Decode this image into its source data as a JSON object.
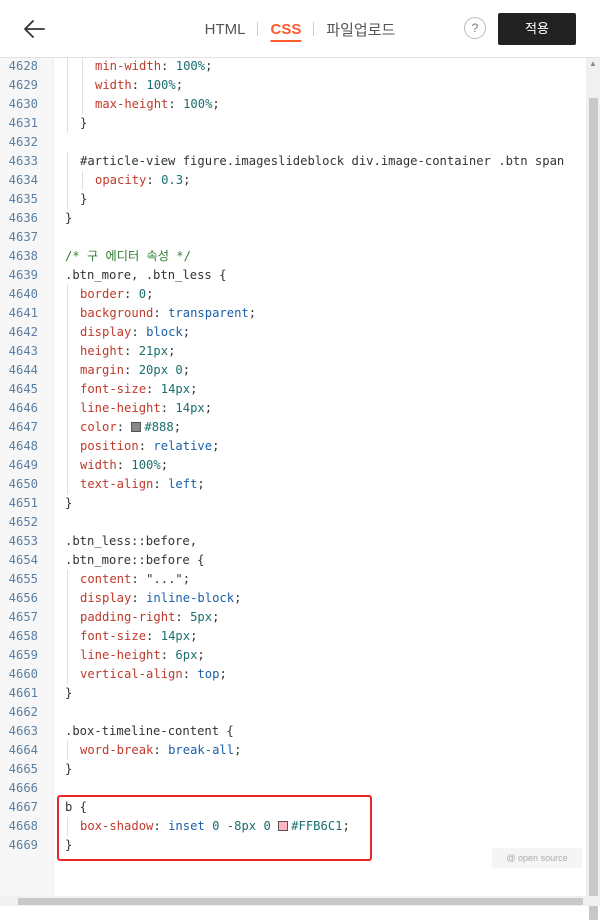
{
  "header": {
    "tabs": [
      {
        "label": "HTML",
        "active": false
      },
      {
        "label": "CSS",
        "active": true
      },
      {
        "label": "파일업로드",
        "active": false
      }
    ],
    "help_label": "?",
    "apply_label": "적용",
    "accent": "#ff5a2e"
  },
  "watermark": "@ open source",
  "code_lines": [
    {
      "n": "4628",
      "indent": 2,
      "tokens": [
        [
          "prop",
          "min-width"
        ],
        [
          "punc",
          ": "
        ],
        [
          "num",
          "100%"
        ],
        [
          "punc",
          ";"
        ]
      ]
    },
    {
      "n": "4629",
      "indent": 2,
      "tokens": [
        [
          "prop",
          "width"
        ],
        [
          "punc",
          ": "
        ],
        [
          "num",
          "100%"
        ],
        [
          "punc",
          ";"
        ]
      ]
    },
    {
      "n": "4630",
      "indent": 2,
      "tokens": [
        [
          "prop",
          "max-height"
        ],
        [
          "punc",
          ": "
        ],
        [
          "num",
          "100%"
        ],
        [
          "punc",
          ";"
        ]
      ]
    },
    {
      "n": "4631",
      "indent": 1,
      "tokens": [
        [
          "punc",
          "}"
        ]
      ]
    },
    {
      "n": "4632",
      "indent": 0,
      "tokens": []
    },
    {
      "n": "4633",
      "indent": 1,
      "tokens": [
        [
          "sel",
          "#article-view figure.imageslideblock div.image-container .btn span"
        ]
      ]
    },
    {
      "n": "4634",
      "indent": 2,
      "tokens": [
        [
          "prop",
          "opacity"
        ],
        [
          "punc",
          ": "
        ],
        [
          "num",
          "0.3"
        ],
        [
          "punc",
          ";"
        ]
      ]
    },
    {
      "n": "4635",
      "indent": 1,
      "tokens": [
        [
          "punc",
          "}"
        ]
      ]
    },
    {
      "n": "4636",
      "indent": 0,
      "tokens": [
        [
          "punc",
          "}"
        ]
      ]
    },
    {
      "n": "4637",
      "indent": 0,
      "tokens": []
    },
    {
      "n": "4638",
      "indent": 0,
      "tokens": [
        [
          "comment",
          "/* 구 에디터 속성 */"
        ]
      ]
    },
    {
      "n": "4639",
      "indent": 0,
      "tokens": [
        [
          "sel",
          ".btn_more, .btn_less {"
        ]
      ]
    },
    {
      "n": "4640",
      "indent": 1,
      "tokens": [
        [
          "prop",
          "border"
        ],
        [
          "punc",
          ": "
        ],
        [
          "num",
          "0"
        ],
        [
          "punc",
          ";"
        ]
      ]
    },
    {
      "n": "4641",
      "indent": 1,
      "tokens": [
        [
          "prop",
          "background"
        ],
        [
          "punc",
          ": "
        ],
        [
          "kw",
          "transparent"
        ],
        [
          "punc",
          ";"
        ]
      ]
    },
    {
      "n": "4642",
      "indent": 1,
      "tokens": [
        [
          "prop",
          "display"
        ],
        [
          "punc",
          ": "
        ],
        [
          "kw",
          "block"
        ],
        [
          "punc",
          ";"
        ]
      ]
    },
    {
      "n": "4643",
      "indent": 1,
      "tokens": [
        [
          "prop",
          "height"
        ],
        [
          "punc",
          ": "
        ],
        [
          "num",
          "21px"
        ],
        [
          "punc",
          ";"
        ]
      ]
    },
    {
      "n": "4644",
      "indent": 1,
      "tokens": [
        [
          "prop",
          "margin"
        ],
        [
          "punc",
          ": "
        ],
        [
          "num",
          "20px 0"
        ],
        [
          "punc",
          ";"
        ]
      ]
    },
    {
      "n": "4645",
      "indent": 1,
      "tokens": [
        [
          "prop",
          "font-size"
        ],
        [
          "punc",
          ": "
        ],
        [
          "num",
          "14px"
        ],
        [
          "punc",
          ";"
        ]
      ]
    },
    {
      "n": "4646",
      "indent": 1,
      "tokens": [
        [
          "prop",
          "line-height"
        ],
        [
          "punc",
          ": "
        ],
        [
          "num",
          "14px"
        ],
        [
          "punc",
          ";"
        ]
      ]
    },
    {
      "n": "4647",
      "indent": 1,
      "tokens": [
        [
          "prop",
          "color"
        ],
        [
          "punc",
          ": "
        ],
        [
          "swatch",
          "#888888"
        ],
        [
          "num",
          "#888"
        ],
        [
          "punc",
          ";"
        ]
      ]
    },
    {
      "n": "4648",
      "indent": 1,
      "tokens": [
        [
          "prop",
          "position"
        ],
        [
          "punc",
          ": "
        ],
        [
          "kw",
          "relative"
        ],
        [
          "punc",
          ";"
        ]
      ]
    },
    {
      "n": "4649",
      "indent": 1,
      "tokens": [
        [
          "prop",
          "width"
        ],
        [
          "punc",
          ": "
        ],
        [
          "num",
          "100%"
        ],
        [
          "punc",
          ";"
        ]
      ]
    },
    {
      "n": "4650",
      "indent": 1,
      "tokens": [
        [
          "prop",
          "text-align"
        ],
        [
          "punc",
          ": "
        ],
        [
          "kw",
          "left"
        ],
        [
          "punc",
          ";"
        ]
      ]
    },
    {
      "n": "4651",
      "indent": 0,
      "tokens": [
        [
          "punc",
          "}"
        ]
      ]
    },
    {
      "n": "4652",
      "indent": 0,
      "tokens": []
    },
    {
      "n": "4653",
      "indent": 0,
      "tokens": [
        [
          "sel",
          ".btn_less::before,"
        ]
      ]
    },
    {
      "n": "4654",
      "indent": 0,
      "tokens": [
        [
          "sel",
          ".btn_more::before {"
        ]
      ]
    },
    {
      "n": "4655",
      "indent": 1,
      "tokens": [
        [
          "prop",
          "content"
        ],
        [
          "punc",
          ": "
        ],
        [
          "str",
          "\"...\""
        ],
        [
          "punc",
          ";"
        ]
      ]
    },
    {
      "n": "4656",
      "indent": 1,
      "tokens": [
        [
          "prop",
          "display"
        ],
        [
          "punc",
          ": "
        ],
        [
          "kw",
          "inline-block"
        ],
        [
          "punc",
          ";"
        ]
      ]
    },
    {
      "n": "4657",
      "indent": 1,
      "tokens": [
        [
          "prop",
          "padding-right"
        ],
        [
          "punc",
          ": "
        ],
        [
          "num",
          "5px"
        ],
        [
          "punc",
          ";"
        ]
      ]
    },
    {
      "n": "4658",
      "indent": 1,
      "tokens": [
        [
          "prop",
          "font-size"
        ],
        [
          "punc",
          ": "
        ],
        [
          "num",
          "14px"
        ],
        [
          "punc",
          ";"
        ]
      ]
    },
    {
      "n": "4659",
      "indent": 1,
      "tokens": [
        [
          "prop",
          "line-height"
        ],
        [
          "punc",
          ": "
        ],
        [
          "num",
          "6px"
        ],
        [
          "punc",
          ";"
        ]
      ]
    },
    {
      "n": "4660",
      "indent": 1,
      "tokens": [
        [
          "prop",
          "vertical-align"
        ],
        [
          "punc",
          ": "
        ],
        [
          "kw",
          "top"
        ],
        [
          "punc",
          ";"
        ]
      ]
    },
    {
      "n": "4661",
      "indent": 0,
      "tokens": [
        [
          "punc",
          "}"
        ]
      ]
    },
    {
      "n": "4662",
      "indent": 0,
      "tokens": []
    },
    {
      "n": "4663",
      "indent": 0,
      "tokens": [
        [
          "sel",
          ".box-timeline-content {"
        ]
      ]
    },
    {
      "n": "4664",
      "indent": 1,
      "tokens": [
        [
          "prop",
          "word-break"
        ],
        [
          "punc",
          ": "
        ],
        [
          "kw",
          "break-all"
        ],
        [
          "punc",
          ";"
        ]
      ]
    },
    {
      "n": "4665",
      "indent": 0,
      "tokens": [
        [
          "punc",
          "}"
        ]
      ]
    },
    {
      "n": "4666",
      "indent": 0,
      "tokens": []
    },
    {
      "n": "4667",
      "indent": 0,
      "tokens": [
        [
          "sel",
          "b {"
        ]
      ]
    },
    {
      "n": "4668",
      "indent": 1,
      "tokens": [
        [
          "prop",
          "box-shadow"
        ],
        [
          "punc",
          ": "
        ],
        [
          "kw",
          "inset"
        ],
        [
          "punc",
          " "
        ],
        [
          "num",
          "0 -8px 0"
        ],
        [
          "punc",
          " "
        ],
        [
          "swatch",
          "#FFB6C1"
        ],
        [
          "num",
          "#FFB6C1"
        ],
        [
          "punc",
          ";"
        ]
      ]
    },
    {
      "n": "4669",
      "indent": 0,
      "tokens": [
        [
          "punc",
          "}"
        ]
      ]
    }
  ]
}
